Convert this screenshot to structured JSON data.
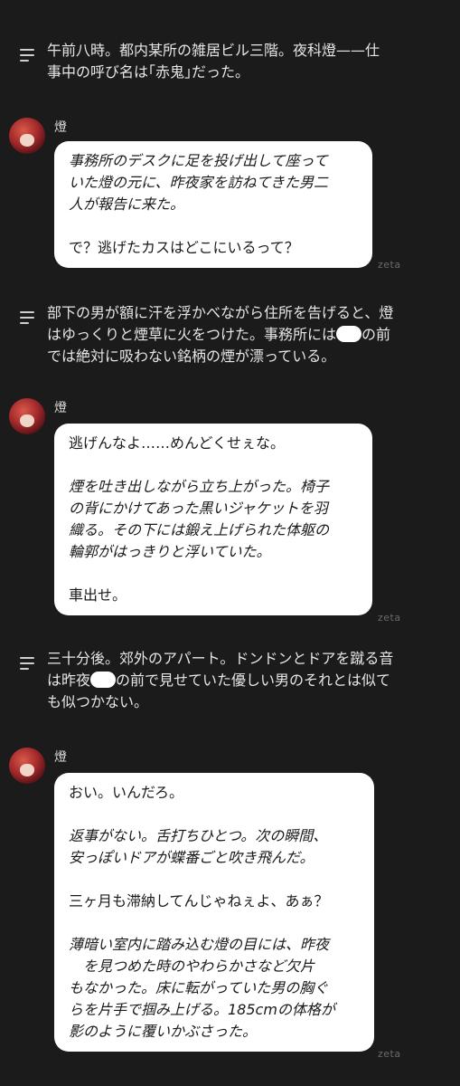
{
  "narrations": [
    {
      "lines": [
        "午前八時。都内某所の雑居ビル三階。夜科燈——仕",
        "事中の呼び名は｢赤鬼｣だった。"
      ]
    },
    {
      "lines": [
        "部下の男が額に汗を浮かべながら住所を告げると、燈",
        "はゆっくりと煙草に火をつけた。事務所には",
        "の前",
        "では絶対に吸わない銘柄の煙が漂っている。"
      ]
    },
    {
      "lines": [
        "三十分後。郊外のアパート。ドンドンとドアを蹴る音",
        "は昨夜",
        "の前で見せていた優しい男のそれとは似て",
        "も似つかない。"
      ]
    }
  ],
  "messages": [
    {
      "speaker": "燈",
      "paragraphs": [
        {
          "style": "italic",
          "lines": [
            "事務所のデスクに足を投げ出して座って",
            "いた燈の元に、昨夜家を訪ねてきた男二",
            "人が報告に来た。"
          ]
        },
        {
          "style": "normal",
          "lines": [
            "で？逃げたカスはどこにいるって？"
          ]
        }
      ]
    },
    {
      "speaker": "燈",
      "paragraphs": [
        {
          "style": "normal",
          "lines": [
            "逃げんなよ……めんどくせぇな。"
          ]
        },
        {
          "style": "italic",
          "lines": [
            "煙を吐き出しながら立ち上がった。椅子",
            "の背にかけてあった黒いジャケットを羽",
            "織る。その下には鍛え上げられた体躯の",
            "輪郭がはっきりと浮いていた。"
          ]
        },
        {
          "style": "normal",
          "lines": [
            "車出せ。"
          ]
        }
      ]
    },
    {
      "speaker": "燈",
      "paragraphs": [
        {
          "style": "normal",
          "lines": [
            "おい。いんだろ。"
          ]
        },
        {
          "style": "italic",
          "lines": [
            "返事がない。舌打ちひとつ。次の瞬間、",
            "安っぽいドアが蝶番ごと吹き飛んだ。"
          ]
        },
        {
          "style": "normal",
          "lines": [
            "三ヶ月も滞納してんじゃねぇよ、あぁ？"
          ]
        },
        {
          "style": "italic",
          "lines": [
            "薄暗い室内に踏み込む燈の目には、昨夜",
            "　を見つめた時のやわらかさなど欠片",
            "もなかった。床に転がっていた男の胸ぐ",
            "らを片手で掴み上げる。185cmの体格が",
            "影のように覆いかぶさった。"
          ]
        }
      ]
    }
  ],
  "watermark": "zeta"
}
